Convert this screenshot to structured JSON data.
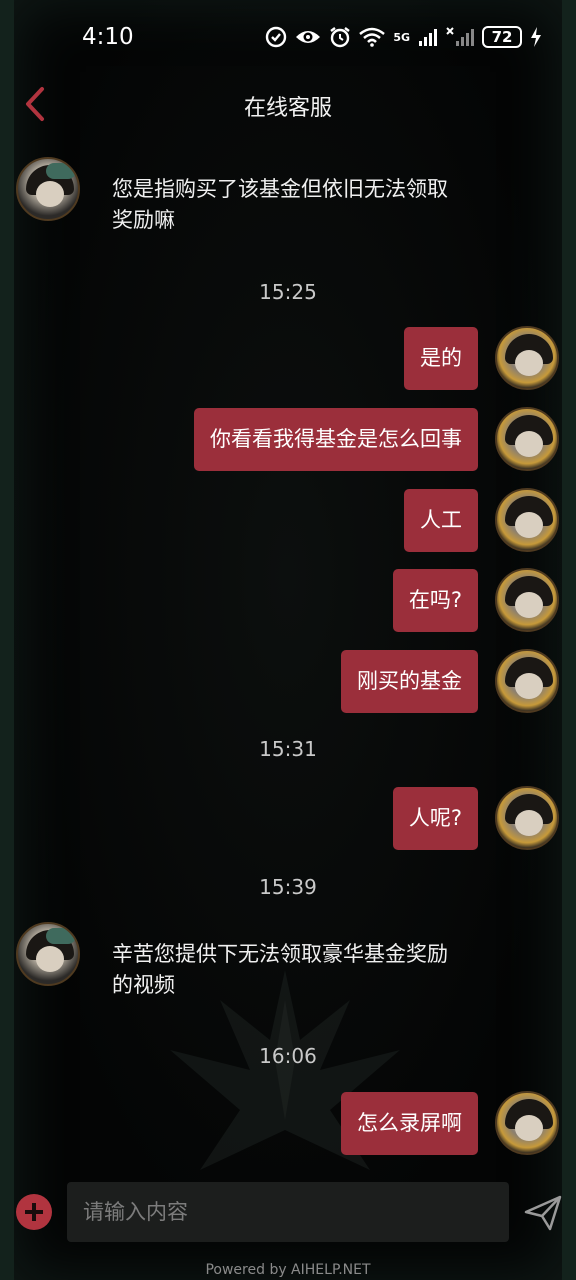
{
  "status_bar": {
    "time": "4:10",
    "signal_label": "5G",
    "battery": "72"
  },
  "header": {
    "title": "在线客服"
  },
  "messages": [
    {
      "from": "agent",
      "text": "您是指购买了该基金但依旧无法领取奖励嘛"
    },
    {
      "timestamp": "15:25"
    },
    {
      "from": "user",
      "text": "是的"
    },
    {
      "from": "user",
      "text": "你看看我得基金是怎么回事"
    },
    {
      "from": "user",
      "text": "人工"
    },
    {
      "from": "user",
      "text": "在吗?"
    },
    {
      "from": "user",
      "text": "刚买的基金"
    },
    {
      "timestamp": "15:31"
    },
    {
      "from": "user",
      "text": "人呢?"
    },
    {
      "timestamp": "15:39"
    },
    {
      "from": "agent",
      "text": "辛苦您提供下无法领取豪华基金奖励的视频"
    },
    {
      "timestamp": "16:06"
    },
    {
      "from": "user",
      "text": "怎么录屏啊"
    }
  ],
  "composer": {
    "placeholder": "请输入内容"
  },
  "footer": {
    "powered_by": "Powered by AIHELP.NET"
  },
  "colors": {
    "bubble": "#9b2f3b",
    "accent": "#b1343f",
    "background": "#050606"
  },
  "icons": [
    "back-icon",
    "plus-icon",
    "send-icon",
    "eye-icon",
    "alarm-icon",
    "wifi-icon",
    "signal-icon",
    "battery-icon",
    "charging-icon"
  ]
}
